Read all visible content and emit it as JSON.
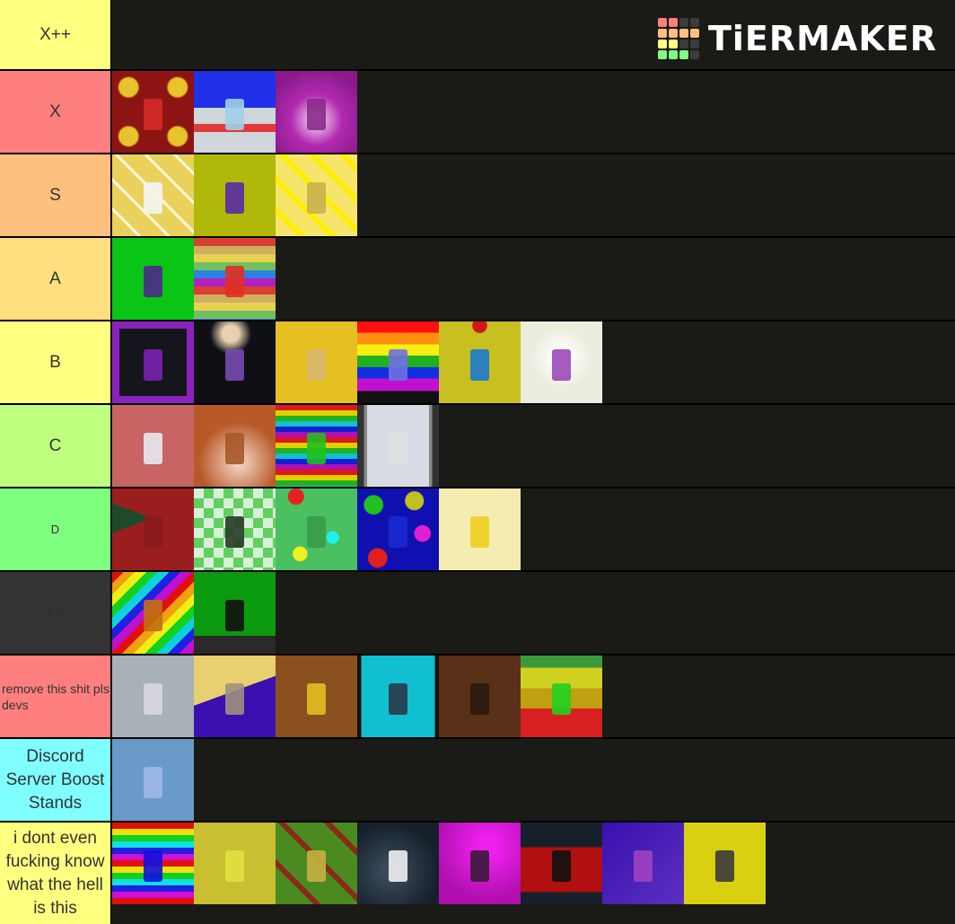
{
  "logo": {
    "text": "TiERMAKER",
    "grid_colors": [
      "#ff7f7f",
      "#ff7f7f",
      "#3b3b3b",
      "#3b3b3b",
      "#ffbf7f",
      "#ffbf7f",
      "#ffbf7f",
      "#ffbf7f",
      "#ffff7f",
      "#ffff7f",
      "#3b3b3b",
      "#3b3b3b",
      "#7fff7f",
      "#7fff7f",
      "#7fff7f",
      "#3b3b3b"
    ]
  },
  "tiers": [
    {
      "label": "X++",
      "color": "#ffff7f",
      "tiles": []
    },
    {
      "label": "X",
      "color": "#ff7f7f",
      "tiles": [
        {
          "bg": "radial-gradient(circle at 20% 20%,#e8c32a 10%,transparent 12%),radial-gradient(circle at 80% 80%,#e8c32a 10%,transparent 12%),radial-gradient(circle at 80% 20%,#e8c32a 10%,transparent 12%),radial-gradient(circle at 20% 80%,#e8c32a 10%,transparent 12%),#8e1414",
          "fig": "#d62828"
        },
        {
          "bg": "linear-gradient(180deg,#2030e8 0 45%,#cfd6dc 45% 65%,#e03a3a 65% 75%,#cfd6dc 75%)",
          "fig": "#9ed0e8"
        },
        {
          "bg": "radial-gradient(circle at 50% 60%,#f0d0f0 5%,#b22ab0 40%,#8a1a8a 80%)",
          "fig": "#8a2a8a"
        }
      ]
    },
    {
      "label": "S",
      "color": "#ffbf7f",
      "tiles": [
        {
          "bg": "repeating-linear-gradient(45deg,#ead15c 0 20px,#fff6d8 20px 23px),#ead15c",
          "fig": "#f4f4f4"
        },
        {
          "bg": "#b0b80a",
          "fig": "#5a2aa8"
        },
        {
          "bg": "repeating-linear-gradient(45deg,#f5e56a 0 18px,#ffee00 18px 24px)",
          "fig": "#c8b050"
        }
      ]
    },
    {
      "label": "A",
      "color": "#ffdf7f",
      "tiles": [
        {
          "bg": "#0ac416",
          "fig": "#4a2a8a"
        },
        {
          "bg": "repeating-linear-gradient(180deg,#d94030 0 9px,#d0b060 9px 18px,#e8d050 18px 27px,#70c060 27px 36px,#3080e0 36px 45px,#b020c0 45px 54px)",
          "fig": "#e03020"
        }
      ]
    },
    {
      "label": "B",
      "color": "#ffff7f",
      "tiles": [
        {
          "bg": "linear-gradient(#15161c,#15161c)",
          "fig": "#7a20b0",
          "border": "#8a22c0"
        },
        {
          "bg": "radial-gradient(circle at 45% 15%,#e8d0b0 10%,transparent 25%),#0e1016",
          "fig": "#7a4ab0"
        },
        {
          "bg": "#e6c020",
          "fig": "#d8b870"
        },
        {
          "bg": "linear-gradient(180deg,#ff1010 0 14%,#ff9010 14% 28%,#f5f010 28% 42%,#20b020 42% 56%,#1030e0 56% 70%,#c010d0 70% 85%,#111 85%)",
          "fig": "#7070e0"
        },
        {
          "bg": "radial-gradient(circle at 50% 5%,#d01818 8%,transparent 9%),#c8c020",
          "fig": "#1a7ad0"
        },
        {
          "bg": "radial-gradient(circle at 50% 45%,#ffffff 10%,#ececdf 50%)",
          "fig": "#9a4ab8"
        }
      ]
    },
    {
      "label": "C",
      "color": "#bfff7f",
      "tiles": [
        {
          "bg": "#c86464",
          "fig": "#e8e8f0"
        },
        {
          "bg": "radial-gradient(circle at 55% 70%,#f0d0c0 5%,#b85a28 55%)",
          "fig": "#a8562a"
        },
        {
          "bg": "repeating-linear-gradient(180deg,#e01818 0 6px,#e0d000 6px 12px,#20b020 12px 18px,#10c0d0 18px 24px,#1020d0 24px 30px,#b010b0 30px 36px)",
          "fig": "#20c020"
        },
        {
          "bg": "linear-gradient(90deg,#333 0 8%,#888 8% 12%,#d8dce4 12% 88%,#888 88% 92%,#333 92%)",
          "fig": "#e0e0e0"
        }
      ]
    },
    {
      "label": "D",
      "color": "#7fff7f",
      "small_label": true,
      "tiles": [
        {
          "bg": "linear-gradient(160deg,transparent 40%,#9a1e1e 40%),linear-gradient(200deg,#9a1e1e 40%,#1f4a2a 40%)",
          "fig": "#8a1a1a"
        },
        {
          "bg": "repeating-conic-gradient(#60d060 0 25%,#d8f0d8 0 50%) 0 0/22px 22px",
          "fig": "#2a3a2a"
        },
        {
          "bg": "radial-gradient(circle at 25% 10%,#e82020 8%,transparent 9%),radial-gradient(circle at 30% 80%,#f0f020 8%,transparent 9%),radial-gradient(circle at 70% 60%,#20f0f0 8%,transparent 9%),#4ac060",
          "fig": "#3a9a4a"
        },
        {
          "bg": "radial-gradient(circle at 20% 20%,#20c020 10%,transparent 11%),radial-gradient(circle at 70% 15%,#c0c020 10%,transparent 11%),radial-gradient(circle at 80% 55%,#e020d0 10%,transparent 11%),radial-gradient(circle at 25% 85%,#e02020 10%,transparent 11%),#1010b0",
          "fig": "#1a2ad0"
        },
        {
          "bg": "#f4ecb0",
          "fig": "#f0d020"
        }
      ]
    },
    {
      "label": "F---",
      "color": "#333333",
      "ghost_label": true,
      "tiles": [
        {
          "bg": "repeating-linear-gradient(135deg,#e01010 0 9px,#f0a010 9px 18px,#f0f010 18px 27px,#10d020 27px 36px,#10d0e0 36px 45px,#2020e0 45px 54px,#c010d0 54px 63px)",
          "fig": "#c07010"
        },
        {
          "bg": "linear-gradient(180deg,#0c9a10 0 78%,#2a2a2a 78%)",
          "fig": "#111"
        }
      ]
    },
    {
      "label": "remove this shit pls devs",
      "color": "#ff7f7f",
      "small_label": true,
      "tiles": [
        {
          "bg": "#a8b0b8",
          "fig": "#d8d8e0"
        },
        {
          "bg": "linear-gradient(160deg,#e8d070 0 45%,#3a10b0 45%)",
          "fig": "#a09080"
        },
        {
          "bg": "#8a5020",
          "fig": "#e0c020"
        },
        {
          "bg": "linear-gradient(90deg,#111 0 5%,#10c0d0 5% 95%,#111 95%)",
          "fig": "#2a3a4a"
        },
        {
          "bg": "#5a3018",
          "fig": "#2a1a10"
        },
        {
          "bg": "linear-gradient(180deg,#3a9a3a 0 15%,#d0d020 15% 40%,#c0a010 40% 65%,#d82020 65%)",
          "fig": "#20d020"
        }
      ]
    },
    {
      "label": "Discord Server Boost Stands",
      "color": "#7fffff",
      "tiles": [
        {
          "bg": "#6a9ac8",
          "fig": "#a0b8e8"
        }
      ]
    },
    {
      "label": "i dont even fucking know what the hell is this",
      "color": "#ffff7f",
      "tiles": [
        {
          "bg": "repeating-linear-gradient(180deg,#e01010 0 7px,#f0e010 7px 14px,#10d020 14px 21px,#10e0e0 21px 28px,#2020e0 28px 35px,#d010d0 35px 42px)",
          "fig": "#1010e0"
        },
        {
          "bg": "#c8c030",
          "fig": "#e0e040"
        },
        {
          "bg": "repeating-linear-gradient(45deg,#4a8a20 0 30px,#8a2a1a 30px 36px),#4a8a20",
          "fig": "#c8b040"
        },
        {
          "bg": "radial-gradient(circle at 40% 60%,#3a4a5a 10%,#15202a 70%)",
          "fig": "#f0f0f0"
        },
        {
          "bg": "radial-gradient(circle at 60% 30%,#f020f0 10%,#b010b0 70%)",
          "fig": "#3a1a3a"
        },
        {
          "bg": "linear-gradient(180deg,#15202a 0 30%,#b01010 30% 85%,#15202a 85%)",
          "fig": "#111"
        },
        {
          "bg": "linear-gradient(135deg,#3a10b0,#5a30c0)",
          "fig": "#a040c0"
        },
        {
          "bg": "#d8d010",
          "fig": "#3a3a3a"
        }
      ]
    }
  ]
}
